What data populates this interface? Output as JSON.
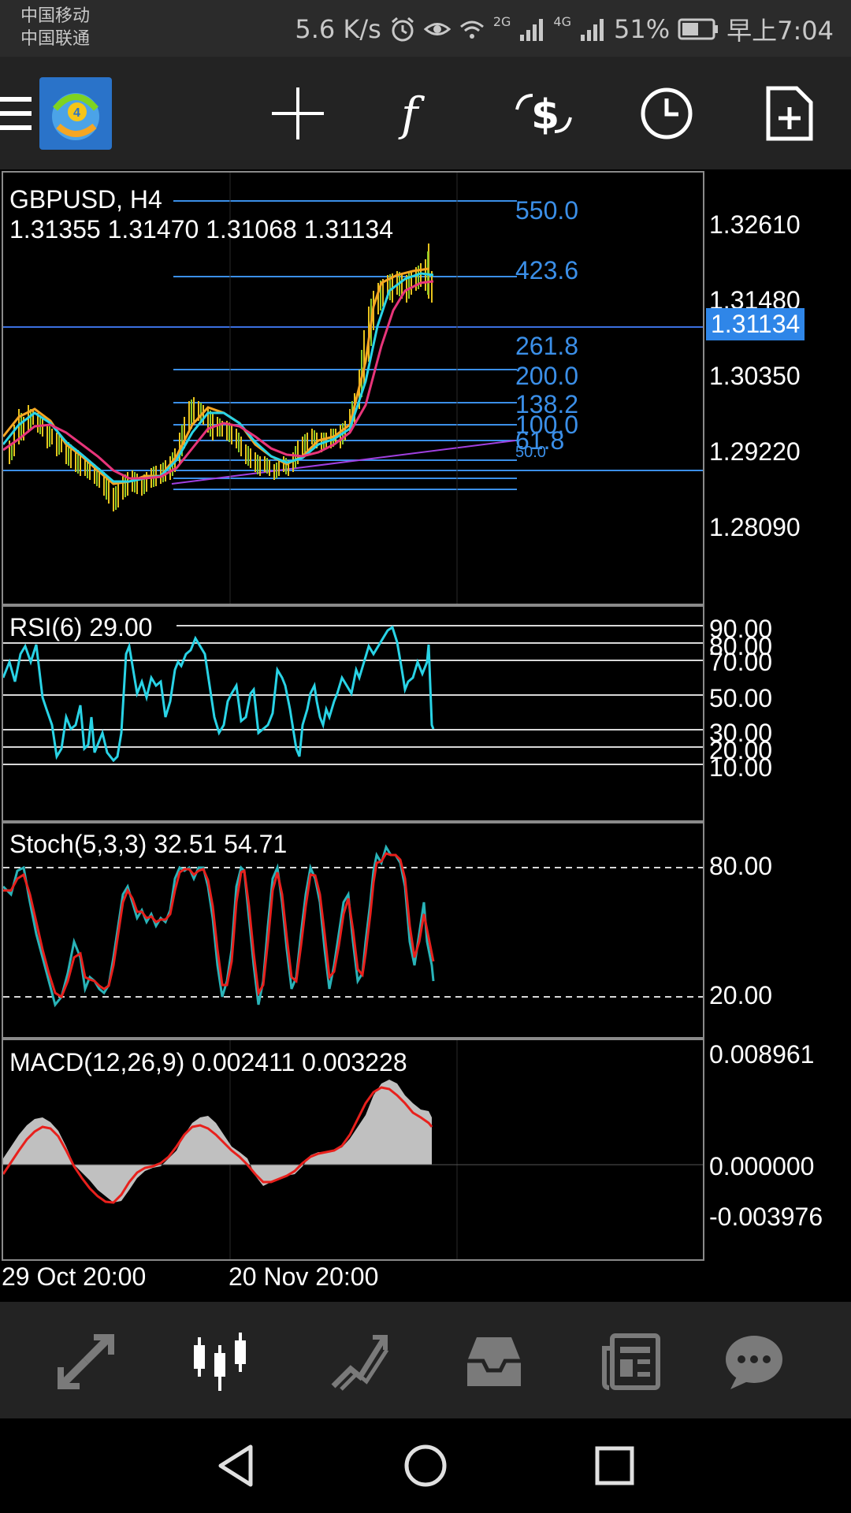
{
  "status_bar": {
    "carrier_1": "中国移动",
    "carrier_2": "中国联通",
    "net_speed": "5.6 K/s",
    "signal_2g": "2G",
    "signal_4g": "4G",
    "battery": "51%",
    "time": "早上7:04"
  },
  "toolbar": {
    "icons": [
      "menu-icon",
      "metatrader-logo",
      "crosshair-icon",
      "function-icon",
      "trade-icon",
      "timeframe-icon",
      "new-order-icon"
    ]
  },
  "chart": {
    "symbol_label": "GBPUSD, H4",
    "ohlc_label": "1.31355 1.31470 1.31068 1.31134",
    "current_price": "1.31134",
    "price_axis": [
      "1.32610",
      "1.31480",
      "1.30350",
      "1.29220",
      "1.28090"
    ],
    "fib_levels": [
      "550.0",
      "423.6",
      "261.8",
      "200.0",
      "138.2",
      "100.0",
      "61.8",
      "50.0"
    ],
    "time_axis": [
      "29 Oct 20:00",
      "20 Nov 20:00"
    ]
  },
  "rsi": {
    "label": "RSI(6) 29.00",
    "levels": [
      "90.00",
      "80.00",
      "70.00",
      "50.00",
      "30.00",
      "20.00",
      "10.00"
    ]
  },
  "stoch": {
    "label": "Stoch(5,3,3) 32.51 54.71",
    "levels": [
      "80.00",
      "20.00"
    ]
  },
  "macd": {
    "label": "MACD(12,26,9) 0.002411 0.003228",
    "levels": [
      "0.008961",
      "0.000000",
      "-0.003976"
    ]
  },
  "bottom_nav": {
    "items": [
      "quotes-icon",
      "chart-icon",
      "trade-icon",
      "history-icon",
      "news-icon",
      "chat-icon"
    ]
  },
  "colors": {
    "fib": "#3b8fe8",
    "price_line": "#e8354a",
    "ma_fast": "#f5a623",
    "ma_mid": "#29d3e6",
    "ma_slow": "#e8357a",
    "rsi": "#29d3e6",
    "stoch_main": "#29b3b8",
    "stoch_signal": "#e8201c",
    "macd_hist": "#c0c0c0",
    "macd_signal": "#e8201c"
  }
}
